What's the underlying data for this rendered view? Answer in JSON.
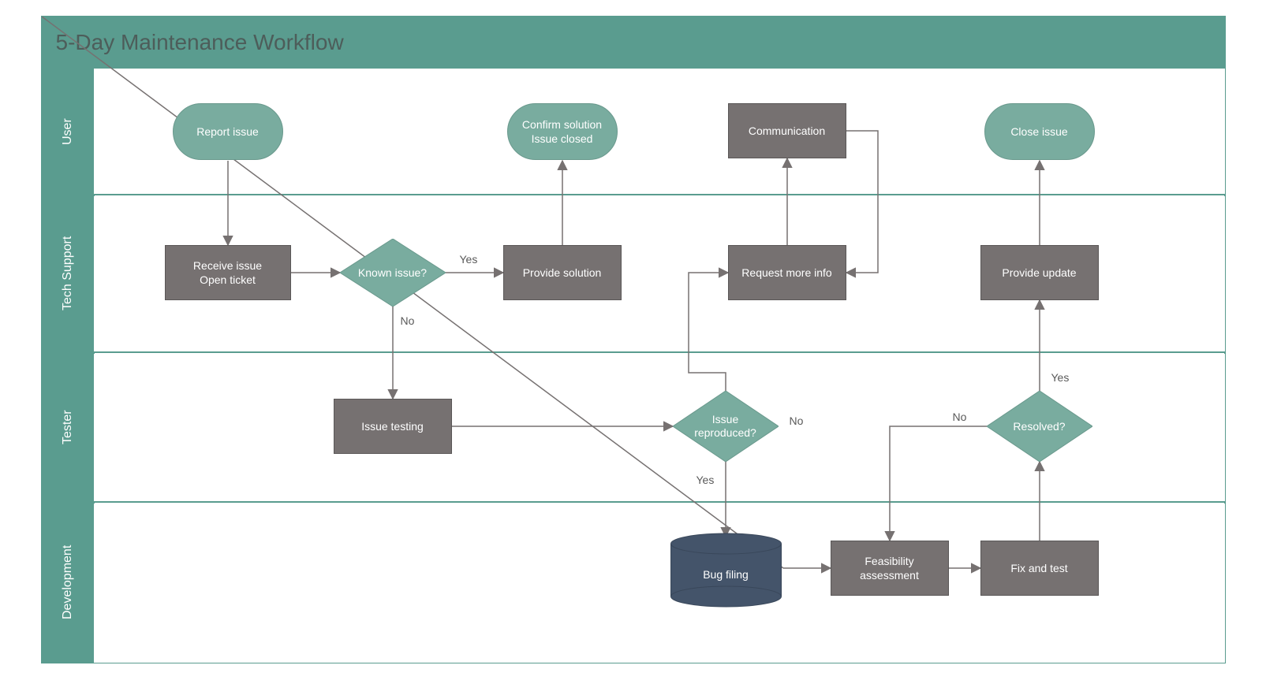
{
  "title": "5-Day Maintenance Workflow",
  "lanes": {
    "user": "User",
    "tech": "Tech Support",
    "tester": "Tester",
    "dev": "Development"
  },
  "nodes": {
    "report_issue": "Report issue",
    "confirm_close": "Confirm solution\nIssue closed",
    "communication": "Communication",
    "close_issue": "Close issue",
    "receive_issue": "Receive issue\nOpen ticket",
    "known_issue": "Known issue?",
    "provide_solution": "Provide solution",
    "request_info": "Request more info",
    "provide_update": "Provide update",
    "issue_testing": "Issue testing",
    "issue_reproduced": "Issue\nreproduced?",
    "resolved": "Resolved?",
    "bug_filing": "Bug filing",
    "feasibility": "Feasibility\nassessment",
    "fix_test": "Fix and test"
  },
  "edge_labels": {
    "known_yes": "Yes",
    "known_no": "No",
    "repro_yes": "Yes",
    "repro_no": "No",
    "resolved_yes": "Yes",
    "resolved_no": "No"
  },
  "colors": {
    "teal": "#5a9c8f",
    "teal_light": "#79ac9f",
    "grey": "#767171",
    "navy": "#44546a"
  }
}
